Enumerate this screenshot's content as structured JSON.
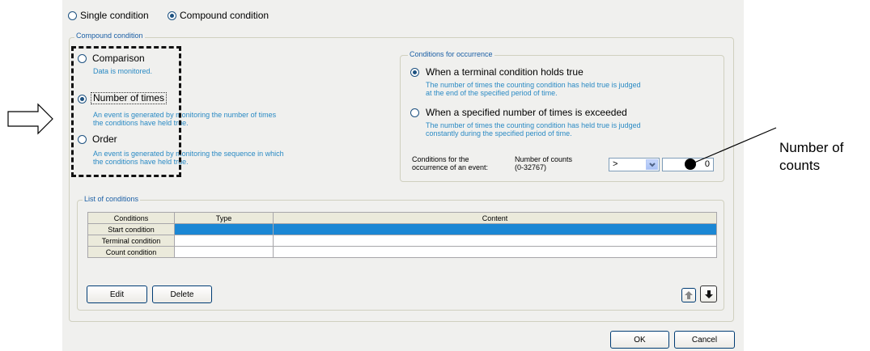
{
  "mode": {
    "single_label": "Single condition",
    "compound_label": "Compound condition",
    "selected": "compound"
  },
  "compound_group": {
    "title": "Compound condition",
    "options": [
      {
        "label": "Comparison",
        "desc": "Data is monitored.",
        "selected": false
      },
      {
        "label": "Number of times",
        "desc": "An event is generated by monitoring the number of times\nthe conditions have held true.",
        "selected": true
      },
      {
        "label": "Order",
        "desc": "An event is generated by monitoring the sequence in which\nthe conditions have held true.",
        "selected": false
      }
    ]
  },
  "occurrence_group": {
    "title": "Conditions for occurrence",
    "options": [
      {
        "label": "When a terminal condition holds true",
        "desc": "The number of times the counting condition has held true is judged\nat the end of the specified period of time.",
        "selected": true
      },
      {
        "label": "When a specified number of times is exceeded",
        "desc": "The number of times the counting condition has held true is judged\nconstantly during the specified period of time.",
        "selected": false
      }
    ],
    "event_label": "Conditions for the\noccurrence of an event:",
    "count_label": "Number of counts\n(0-32767)",
    "operator": ">",
    "count_value": "0"
  },
  "list_group": {
    "title": "List of conditions",
    "columns": [
      "Conditions",
      "Type",
      "Content"
    ],
    "rows": [
      {
        "name": "Start condition",
        "type": "",
        "content": ""
      },
      {
        "name": "Terminal condition",
        "type": "",
        "content": ""
      },
      {
        "name": "Count condition",
        "type": "",
        "content": ""
      }
    ],
    "edit_label": "Edit",
    "delete_label": "Delete"
  },
  "footer": {
    "ok_label": "OK",
    "cancel_label": "Cancel"
  },
  "callout": {
    "text": "Number of\ncounts"
  },
  "colors": {
    "accent_text": "#2a8ac4",
    "selection": "#1b87d4",
    "dialog_bg": "#f0f0ee"
  }
}
